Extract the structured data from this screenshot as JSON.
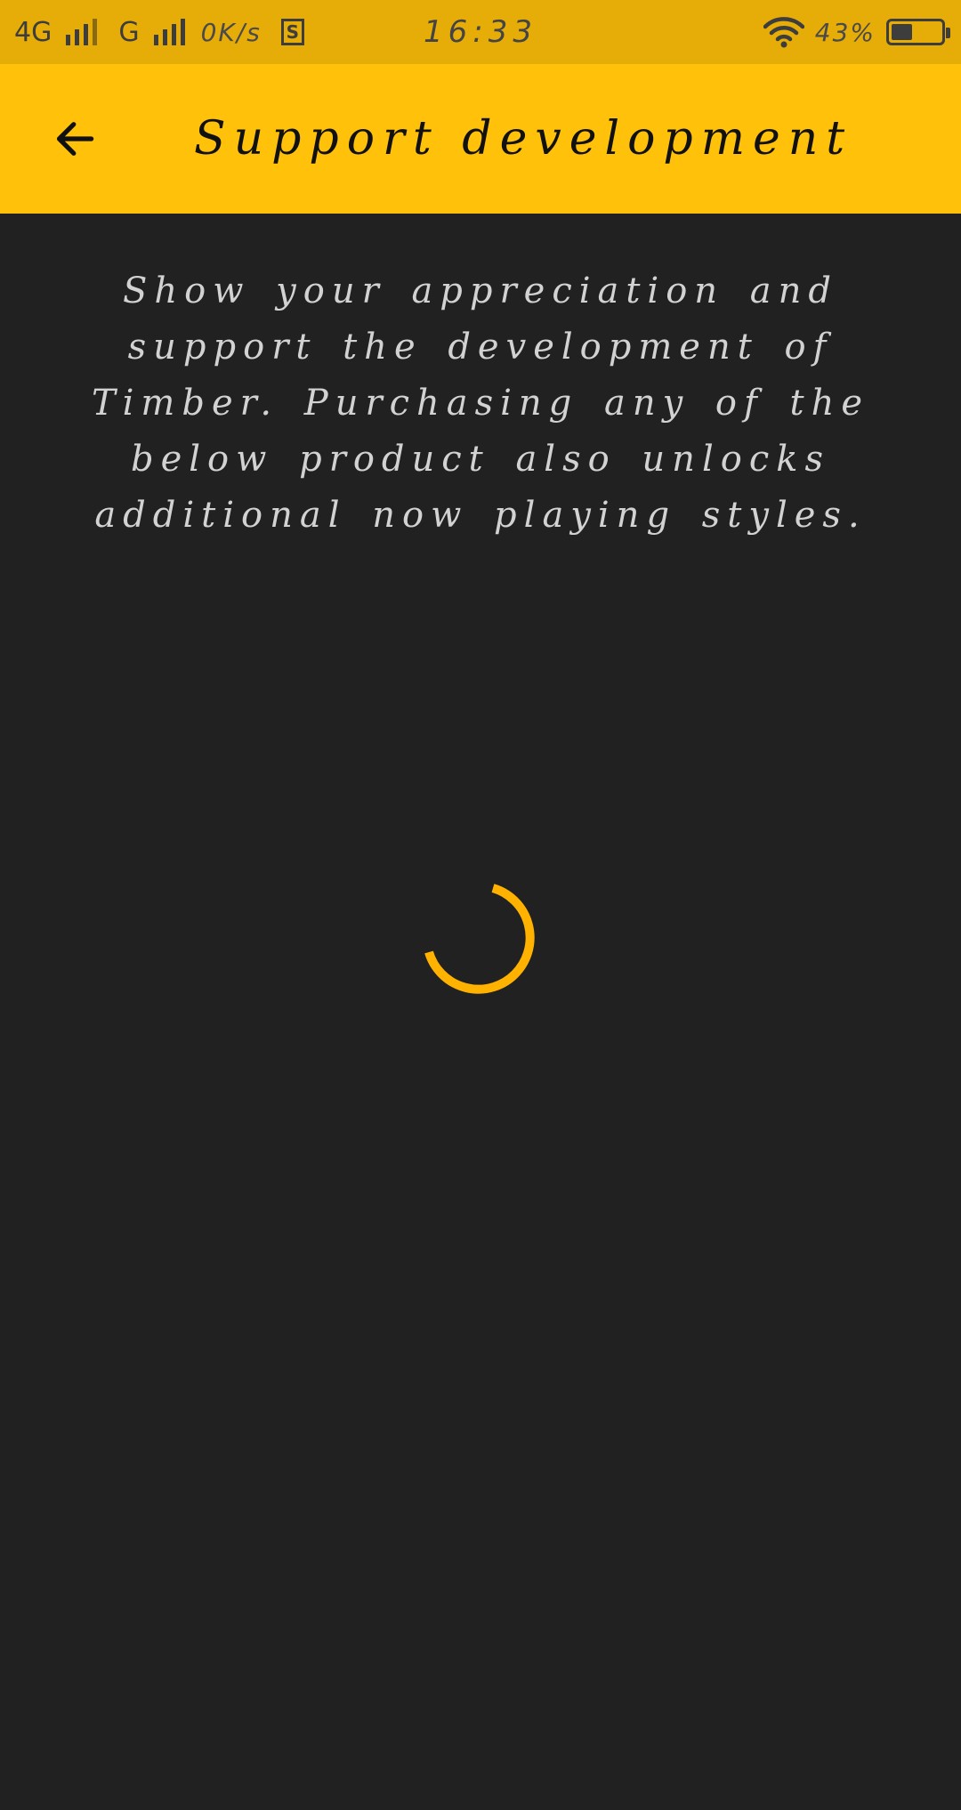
{
  "status_bar": {
    "network_1": "4G",
    "network_2": "G",
    "speed": "0K/s",
    "sim_label": "S",
    "time": "16:33",
    "battery_percent": "43%",
    "battery_level": 0.43
  },
  "app_bar": {
    "title": "Support development",
    "back_icon": "arrow-left-icon"
  },
  "main": {
    "description": "Show your appreciation and support the development of Timber. Purchasing any of the below product also unlocks additional now playing styles."
  },
  "colors": {
    "status_bar_bg": "#e6ac07",
    "accent": "#ffc10a",
    "background": "#212121",
    "spinner": "#ffb300"
  }
}
